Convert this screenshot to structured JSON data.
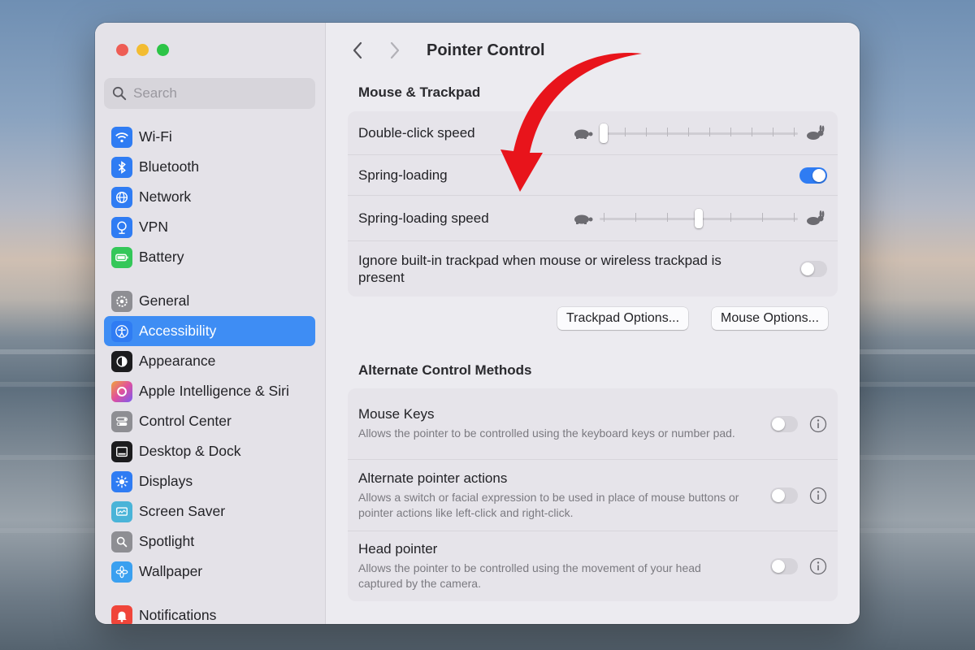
{
  "window": {
    "title": "Pointer Control"
  },
  "sidebar": {
    "search_placeholder": "Search",
    "items": [
      {
        "label": "Wi-Fi",
        "icon": "wifi-icon",
        "color": "#2f7cf3"
      },
      {
        "label": "Bluetooth",
        "icon": "bluetooth-icon",
        "color": "#2f7cf3"
      },
      {
        "label": "Network",
        "icon": "globe-icon",
        "color": "#2f7cf3"
      },
      {
        "label": "VPN",
        "icon": "vpn-icon",
        "color": "#2f7cf3"
      },
      {
        "label": "Battery",
        "icon": "battery-icon",
        "color": "#34c759"
      },
      {
        "label": "General",
        "icon": "gear-icon",
        "color": "#8e8e93"
      },
      {
        "label": "Accessibility",
        "icon": "accessibility-icon",
        "color": "#2f7cf3",
        "active": true
      },
      {
        "label": "Appearance",
        "icon": "appearance-icon",
        "color": "#1c1c1e"
      },
      {
        "label": "Apple Intelligence & Siri",
        "icon": "siri-icon",
        "color": "#d65ad9"
      },
      {
        "label": "Control Center",
        "icon": "control-center-icon",
        "color": "#8e8e93"
      },
      {
        "label": "Desktop & Dock",
        "icon": "dock-icon",
        "color": "#1c1c1e"
      },
      {
        "label": "Displays",
        "icon": "sun-icon",
        "color": "#2f7cf3"
      },
      {
        "label": "Screen Saver",
        "icon": "screen-saver-icon",
        "color": "#4ab4d8"
      },
      {
        "label": "Spotlight",
        "icon": "spotlight-icon",
        "color": "#8e8e93"
      },
      {
        "label": "Wallpaper",
        "icon": "wallpaper-icon",
        "color": "#3aa0f0"
      },
      {
        "label": "Notifications",
        "icon": "bell-icon",
        "color": "#f0453a"
      }
    ]
  },
  "mouse_trackpad": {
    "title": "Mouse & Trackpad",
    "double_click": {
      "label": "Double-click speed",
      "value": 0,
      "ticks": 10
    },
    "spring_loading": {
      "label": "Spring-loading",
      "on": true
    },
    "spring_speed": {
      "label": "Spring-loading speed",
      "value": 0.5,
      "ticks": 7
    },
    "ignore_trackpad": {
      "label": "Ignore built-in trackpad when mouse or wireless trackpad is present",
      "on": false
    },
    "trackpad_options": "Trackpad Options...",
    "mouse_options": "Mouse Options..."
  },
  "alternate": {
    "title": "Alternate Control Methods",
    "mouse_keys": {
      "label": "Mouse Keys",
      "desc": "Allows the pointer to be controlled using the keyboard keys or number pad.",
      "on": false
    },
    "pointer_actions": {
      "label": "Alternate pointer actions",
      "desc": "Allows a switch or facial expression to be used in place of mouse buttons or pointer actions like left-click and right-click.",
      "on": false
    },
    "head_pointer": {
      "label": "Head pointer",
      "desc": "Allows the pointer to be controlled using the movement of your head captured by the camera.",
      "on": false
    }
  },
  "annotation": {
    "arrow_color": "#e8141b"
  }
}
